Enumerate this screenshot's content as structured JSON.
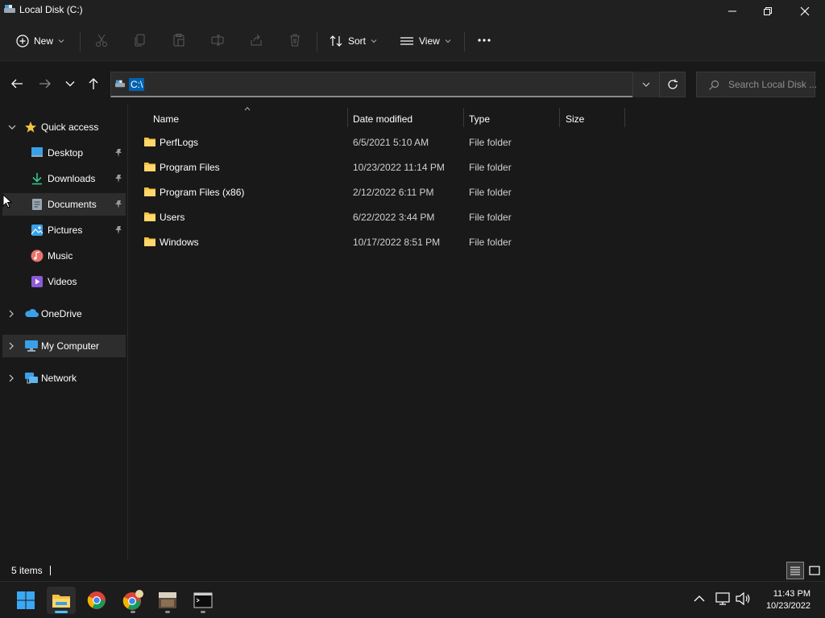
{
  "window": {
    "title": "Local Disk (C:)"
  },
  "toolbar": {
    "new_label": "New",
    "sort_label": "Sort",
    "view_label": "View"
  },
  "address": {
    "path": "C:\\"
  },
  "search": {
    "placeholder": "Search Local Disk ..."
  },
  "sidebar": {
    "quick_access": "Quick access",
    "items": [
      "Desktop",
      "Downloads",
      "Documents",
      "Pictures",
      "Music",
      "Videos"
    ],
    "onedrive": "OneDrive",
    "my_computer": "My Computer",
    "network": "Network"
  },
  "columns": {
    "name": "Name",
    "date": "Date modified",
    "type": "Type",
    "size": "Size"
  },
  "files": [
    {
      "name": "PerfLogs",
      "date": "6/5/2021 5:10 AM",
      "type": "File folder",
      "size": ""
    },
    {
      "name": "Program Files",
      "date": "10/23/2022 11:14 PM",
      "type": "File folder",
      "size": ""
    },
    {
      "name": "Program Files (x86)",
      "date": "2/12/2022 6:11 PM",
      "type": "File folder",
      "size": ""
    },
    {
      "name": "Users",
      "date": "6/22/2022 3:44 PM",
      "type": "File folder",
      "size": ""
    },
    {
      "name": "Windows",
      "date": "10/17/2022 8:51 PM",
      "type": "File folder",
      "size": ""
    }
  ],
  "status": {
    "count": "5 items"
  },
  "clock": {
    "time": "11:43 PM",
    "date": "10/23/2022"
  },
  "colors": {
    "accent": "#0063b1",
    "folder": "#f5c244",
    "background": "#191919"
  }
}
